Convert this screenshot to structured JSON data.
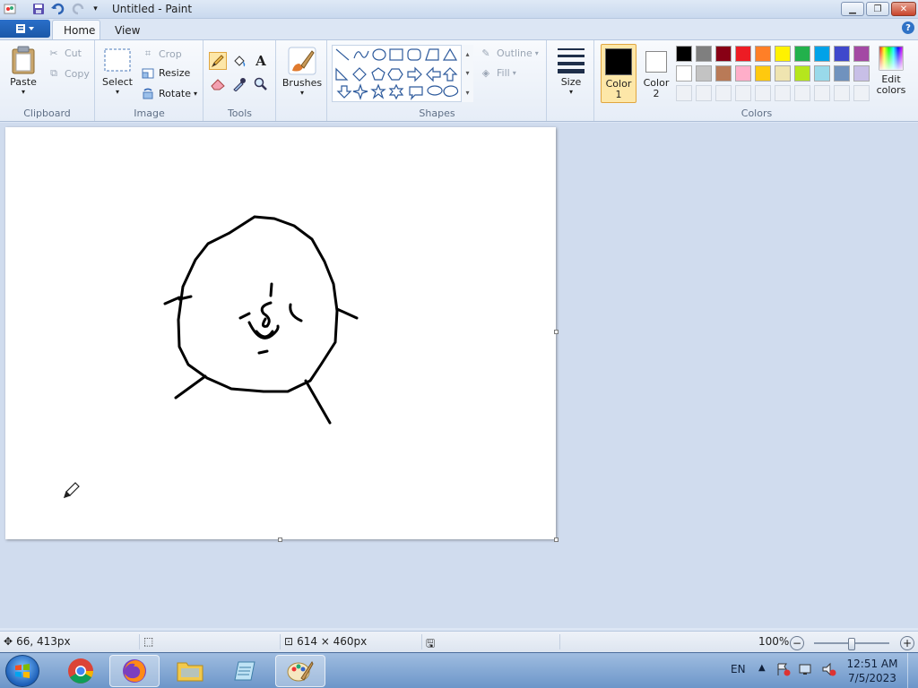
{
  "window": {
    "title": "Untitled - Paint"
  },
  "tabs": {
    "home": "Home",
    "view": "View"
  },
  "ribbon": {
    "clipboard": {
      "label": "Clipboard",
      "paste": "Paste",
      "cut": "Cut",
      "copy": "Copy"
    },
    "image": {
      "label": "Image",
      "select": "Select",
      "crop": "Crop",
      "resize": "Resize",
      "rotate": "Rotate"
    },
    "tools": {
      "label": "Tools",
      "text_glyph": "A"
    },
    "brushes": {
      "label": "Brushes"
    },
    "shapes": {
      "label": "Shapes",
      "outline": "Outline",
      "fill": "Fill"
    },
    "size": {
      "label": "Size"
    },
    "colors": {
      "label": "Colors",
      "color1": "Color",
      "color1_num": "1",
      "color2": "Color",
      "color2_num": "2",
      "edit": "Edit",
      "edit2": "colors",
      "color1_value": "#000000",
      "color2_value": "#ffffff",
      "palette_row1": [
        "#000000",
        "#7f7f7f",
        "#880015",
        "#ed1c24",
        "#ff7f27",
        "#fff200",
        "#22b14c",
        "#00a2e8",
        "#3f48cc",
        "#a349a4"
      ],
      "palette_row2": [
        "#ffffff",
        "#c3c3c3",
        "#b97a57",
        "#ffaec9",
        "#ffc90e",
        "#efe4b0",
        "#b5e61d",
        "#99d9ea",
        "#7092be",
        "#c8bfe7"
      ]
    }
  },
  "status": {
    "cursor_pos": "66, 413px",
    "image_size": "614 × 460px",
    "zoom": "100%",
    "zoom_fraction": 0.5
  },
  "taskbar": {
    "lang": "EN",
    "time": "12:51 AM",
    "date": "7/5/2023"
  }
}
